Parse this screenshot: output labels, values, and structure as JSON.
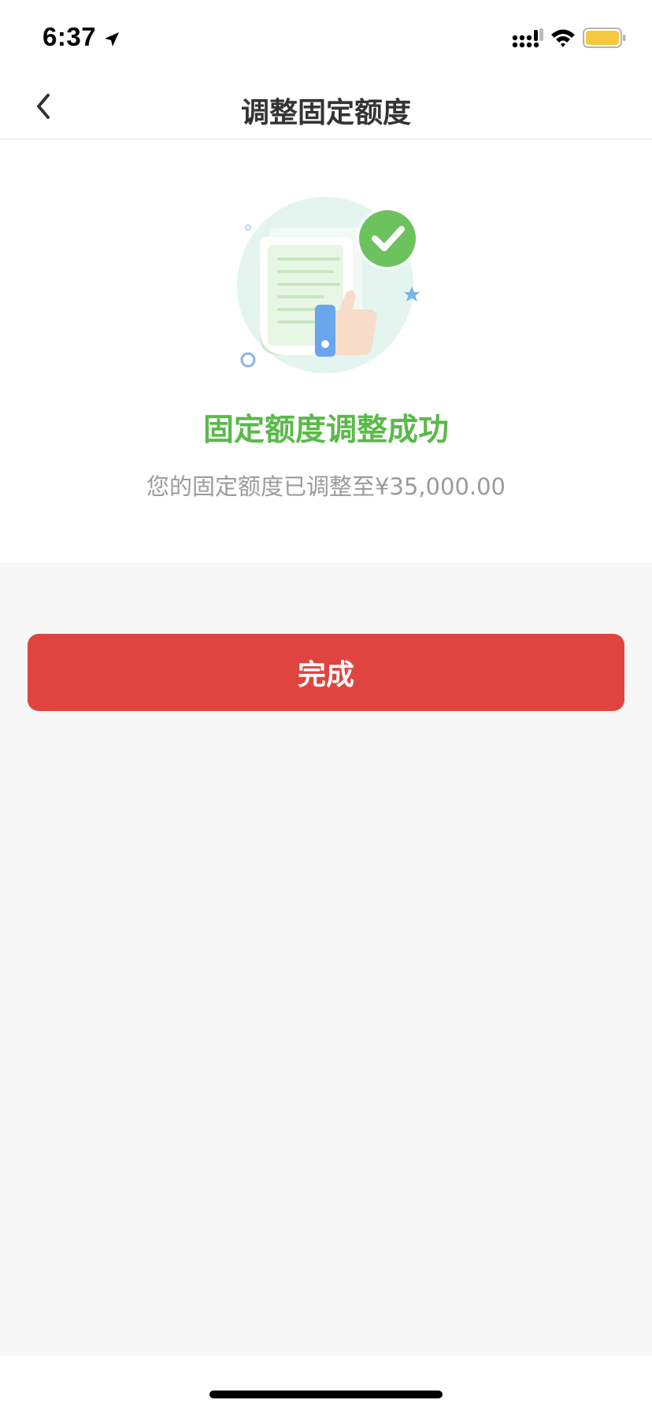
{
  "status_bar": {
    "time": "6:37",
    "icons": [
      "location-arrow-icon",
      "signal-icon",
      "wifi-icon",
      "battery-icon"
    ],
    "battery_color": "#f5c842"
  },
  "nav": {
    "back_icon": "chevron-left-icon",
    "title": "调整固定额度"
  },
  "result": {
    "illustration_icon": "document-approved-thumbs-up-icon",
    "title": "固定额度调整成功",
    "message": "您的固定额度已调整至¥35,000.00",
    "title_color": "#5bb94a"
  },
  "actions": {
    "done_label": "完成",
    "done_color": "#e0443f"
  }
}
